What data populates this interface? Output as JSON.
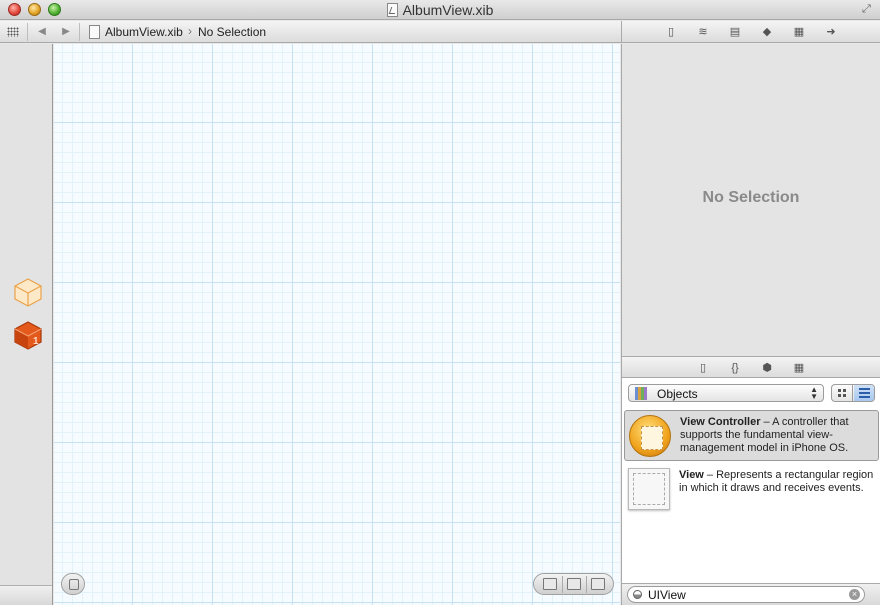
{
  "window": {
    "title": "AlbumView.xib"
  },
  "jumpbar": {
    "file": "AlbumView.xib",
    "selection": "No Selection"
  },
  "inspector": {
    "empty_message": "No Selection"
  },
  "library": {
    "category": "Objects",
    "items": [
      {
        "name": "View Controller",
        "description": " – A controller that supports the fundamental view-management model in iPhone OS.",
        "selected": true
      },
      {
        "name": "View",
        "description": " – Represents a rectangular region in which it draws and receives events.",
        "selected": false
      }
    ],
    "filter": {
      "value": "UIView"
    }
  },
  "colors": {
    "canvas_grid": "#c6e2f2",
    "selection_blue": "#a8c8ee",
    "vc_icon": "#f0a21c"
  }
}
